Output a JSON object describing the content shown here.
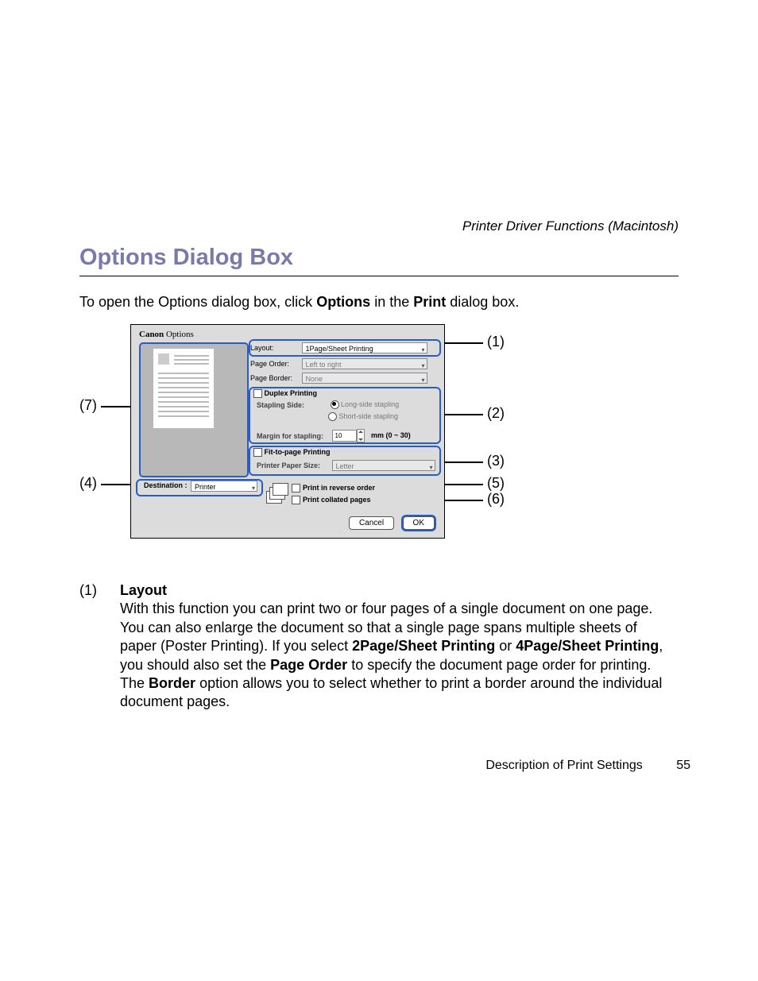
{
  "header": "Printer Driver Functions (Macintosh)",
  "title": "Options Dialog Box",
  "title_color": "#7a7aa8",
  "intro": {
    "p1": "To open the Options dialog box, click ",
    "b1": "Options",
    "p2": " in the ",
    "b2": "Print",
    "p3": " dialog box."
  },
  "callouts": {
    "c1": "(1)",
    "c2": "(2)",
    "c3": "(3)",
    "c4": "(4)",
    "c5": "(5)",
    "c6": "(6)",
    "c7": "(7)"
  },
  "figure": {
    "brand": "Canon",
    "win": "Options",
    "layout_lbl": "Layout:",
    "layout_val": "1Page/Sheet Printing",
    "order_lbl": "Page Order:",
    "order_val": "Left to right",
    "border_lbl": "Page Border:",
    "border_val": "None",
    "duplex_lbl": "Duplex Printing",
    "stapling_lbl": "Stapling Side:",
    "long_side": "Long-side stapling",
    "short_side": "Short-side stapling",
    "margin_lbl": "Margin for stapling:",
    "margin_val": "10",
    "margin_range": "mm (0 ~ 30)",
    "fit_lbl": "Fit-to-page Printing",
    "paper_lbl": "Printer Paper Size:",
    "paper_val": "Letter",
    "dest_lbl": "Destination :",
    "dest_val": "Printer",
    "reverse_lbl": "Print in reverse order",
    "collated_lbl": "Print collated pages",
    "cancel": "Cancel",
    "ok": "OK"
  },
  "desc": {
    "num": "(1)",
    "head": "Layout",
    "t1": "With this function you can print two or four pages of a single document on one page. You can also enlarge the document so that a single page spans multiple sheets of paper (Poster Printing). If you select ",
    "b1": "2Page/Sheet Printing",
    "t2": " or ",
    "b2": "4Page/Sheet Printing",
    "t3": ", you should also set the ",
    "b3": "Page Order",
    "t4": " to specify the document page order for printing. The ",
    "b4": "Border",
    "t5": " option allows you to select whether to print a border around the individual document pages."
  },
  "footer": {
    "text": "Description of Print Settings",
    "page": "55"
  }
}
